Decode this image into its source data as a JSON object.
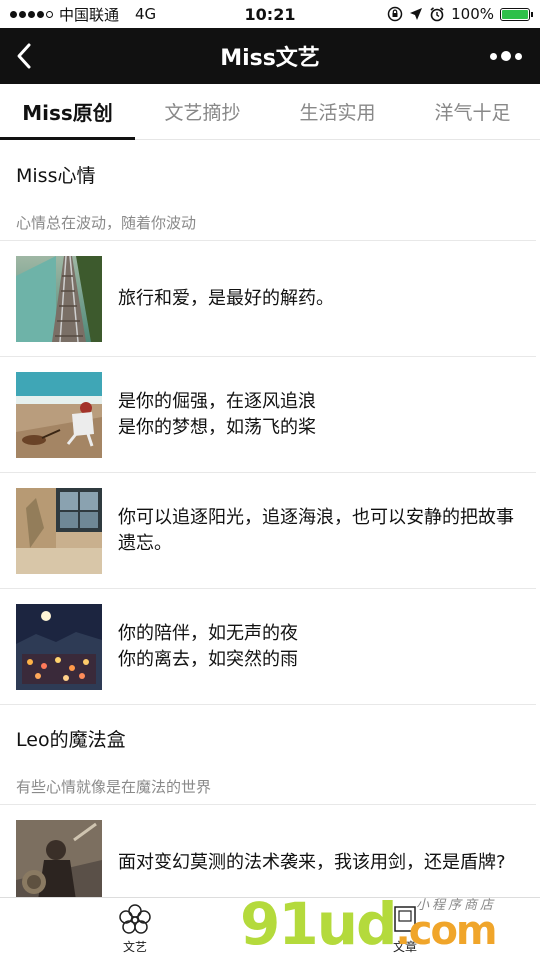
{
  "status_bar": {
    "carrier": "中国联通",
    "network": "4G",
    "time": "10:21",
    "battery": "100%",
    "battery_level": 1.0
  },
  "nav": {
    "title": "Miss文艺"
  },
  "tabs": [
    {
      "label": "Miss原创",
      "active": true
    },
    {
      "label": "文艺摘抄",
      "active": false
    },
    {
      "label": "生活实用",
      "active": false
    },
    {
      "label": "洋气十足",
      "active": false
    }
  ],
  "sections": [
    {
      "title": "Miss心情",
      "description": "心情总在波动，随着你波动",
      "articles": [
        {
          "lines": [
            "旅行和爱，是最好的解药。"
          ],
          "thumb": "railway-icon"
        },
        {
          "lines": [
            "是你的倔强，在逐风追浪",
            "是你的梦想，如荡飞的桨"
          ],
          "thumb": "beach-icon"
        },
        {
          "lines": [
            "你可以追逐阳光，追逐海浪，也可以安静的把故事遗忘。"
          ],
          "thumb": "window-icon"
        },
        {
          "lines": [
            "你的陪伴，如无声的夜",
            "你的离去，如突然的雨"
          ],
          "thumb": "night-town-icon"
        }
      ]
    },
    {
      "title": "Leo的魔法盒",
      "description": "有些心情就像是在魔法的世界",
      "articles": [
        {
          "lines": [
            "面对变幻莫测的法术袭来，我该用剑，还是盾牌?"
          ],
          "thumb": "battle-icon"
        }
      ]
    }
  ],
  "tab_bar": [
    {
      "label": "文艺",
      "icon": "flower-icon"
    },
    {
      "label": "文章",
      "icon": "article-icon"
    }
  ],
  "watermark": {
    "main": "91ud",
    "suffix": ".com",
    "small": "小程序商店"
  }
}
